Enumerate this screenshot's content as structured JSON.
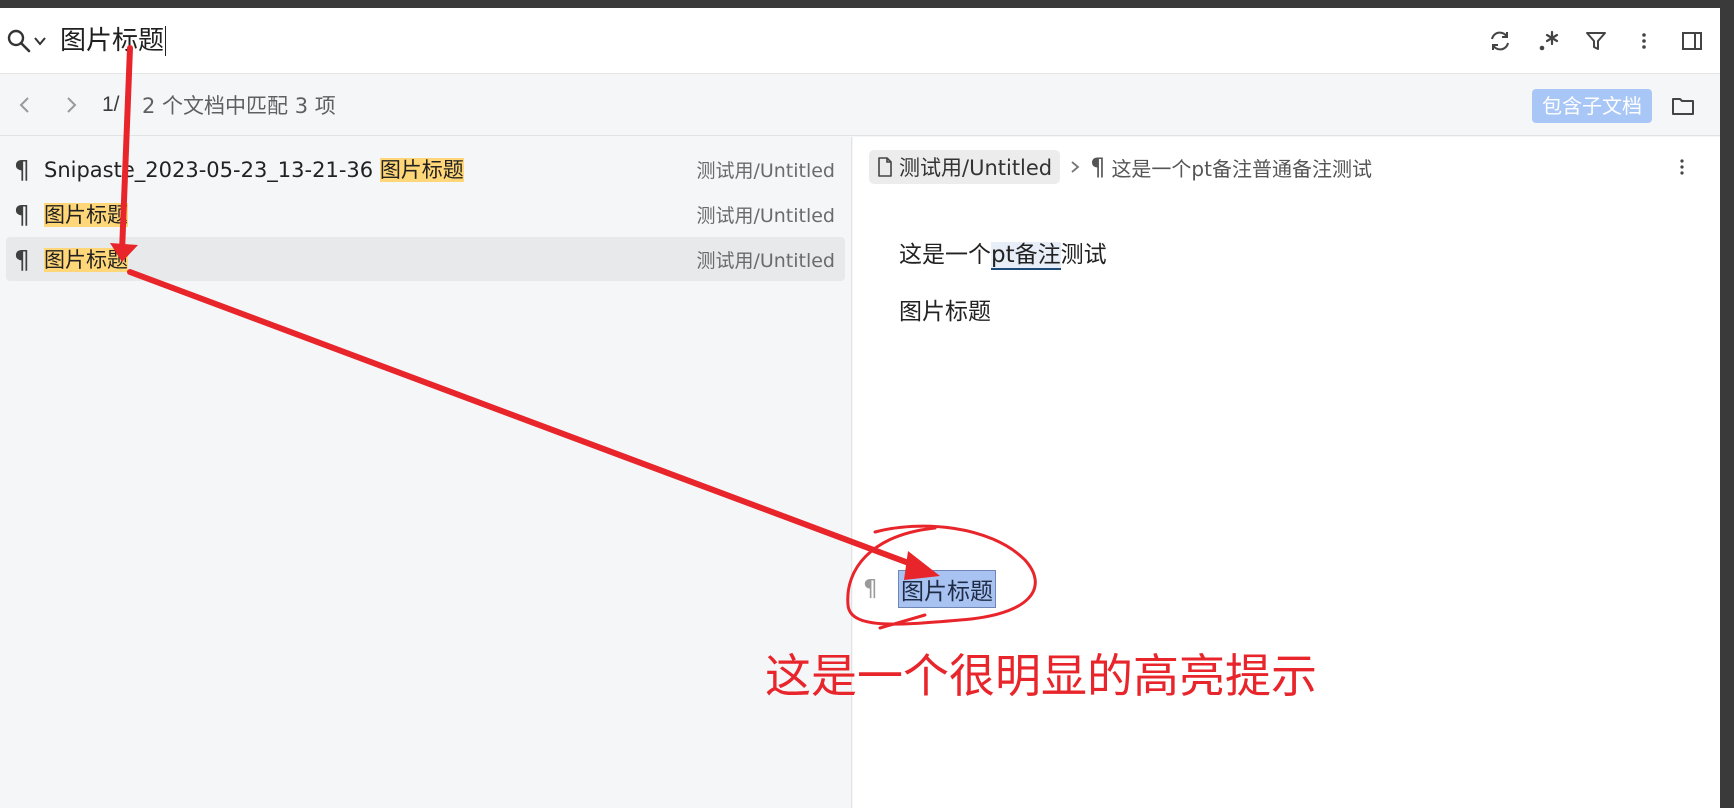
{
  "search": {
    "query": "图片标题"
  },
  "toolbar": {
    "page_count": "1/",
    "match_summary": "2 个文档中匹配 3 项",
    "include_children_label": "包含子文档"
  },
  "results": [
    {
      "before": "Snipaste_2023-05-23_13-21-36 ",
      "match": "图片标题",
      "path": "测试用/Untitled"
    },
    {
      "before": "",
      "match": "图片标题",
      "path": "测试用/Untitled"
    },
    {
      "before": "",
      "match": "图片标题",
      "path": "测试用/Untitled"
    }
  ],
  "preview": {
    "breadcrumb_doc": "测试用/Untitled",
    "breadcrumb_block": "这是一个pt备注普通备注测试",
    "para1_before": "这是一个",
    "para1_annot": "pt备注",
    "para1_after": "测试",
    "para2": "图片标题",
    "focus_block": "图片标题"
  },
  "overlay": {
    "caption": "这是一个很明显的高亮提示",
    "color": "#e8252b"
  },
  "colors": {
    "match_highlight": "#ffd778",
    "focus_highlight": "#a8c3f2",
    "include_button": "#a9c7f6"
  }
}
